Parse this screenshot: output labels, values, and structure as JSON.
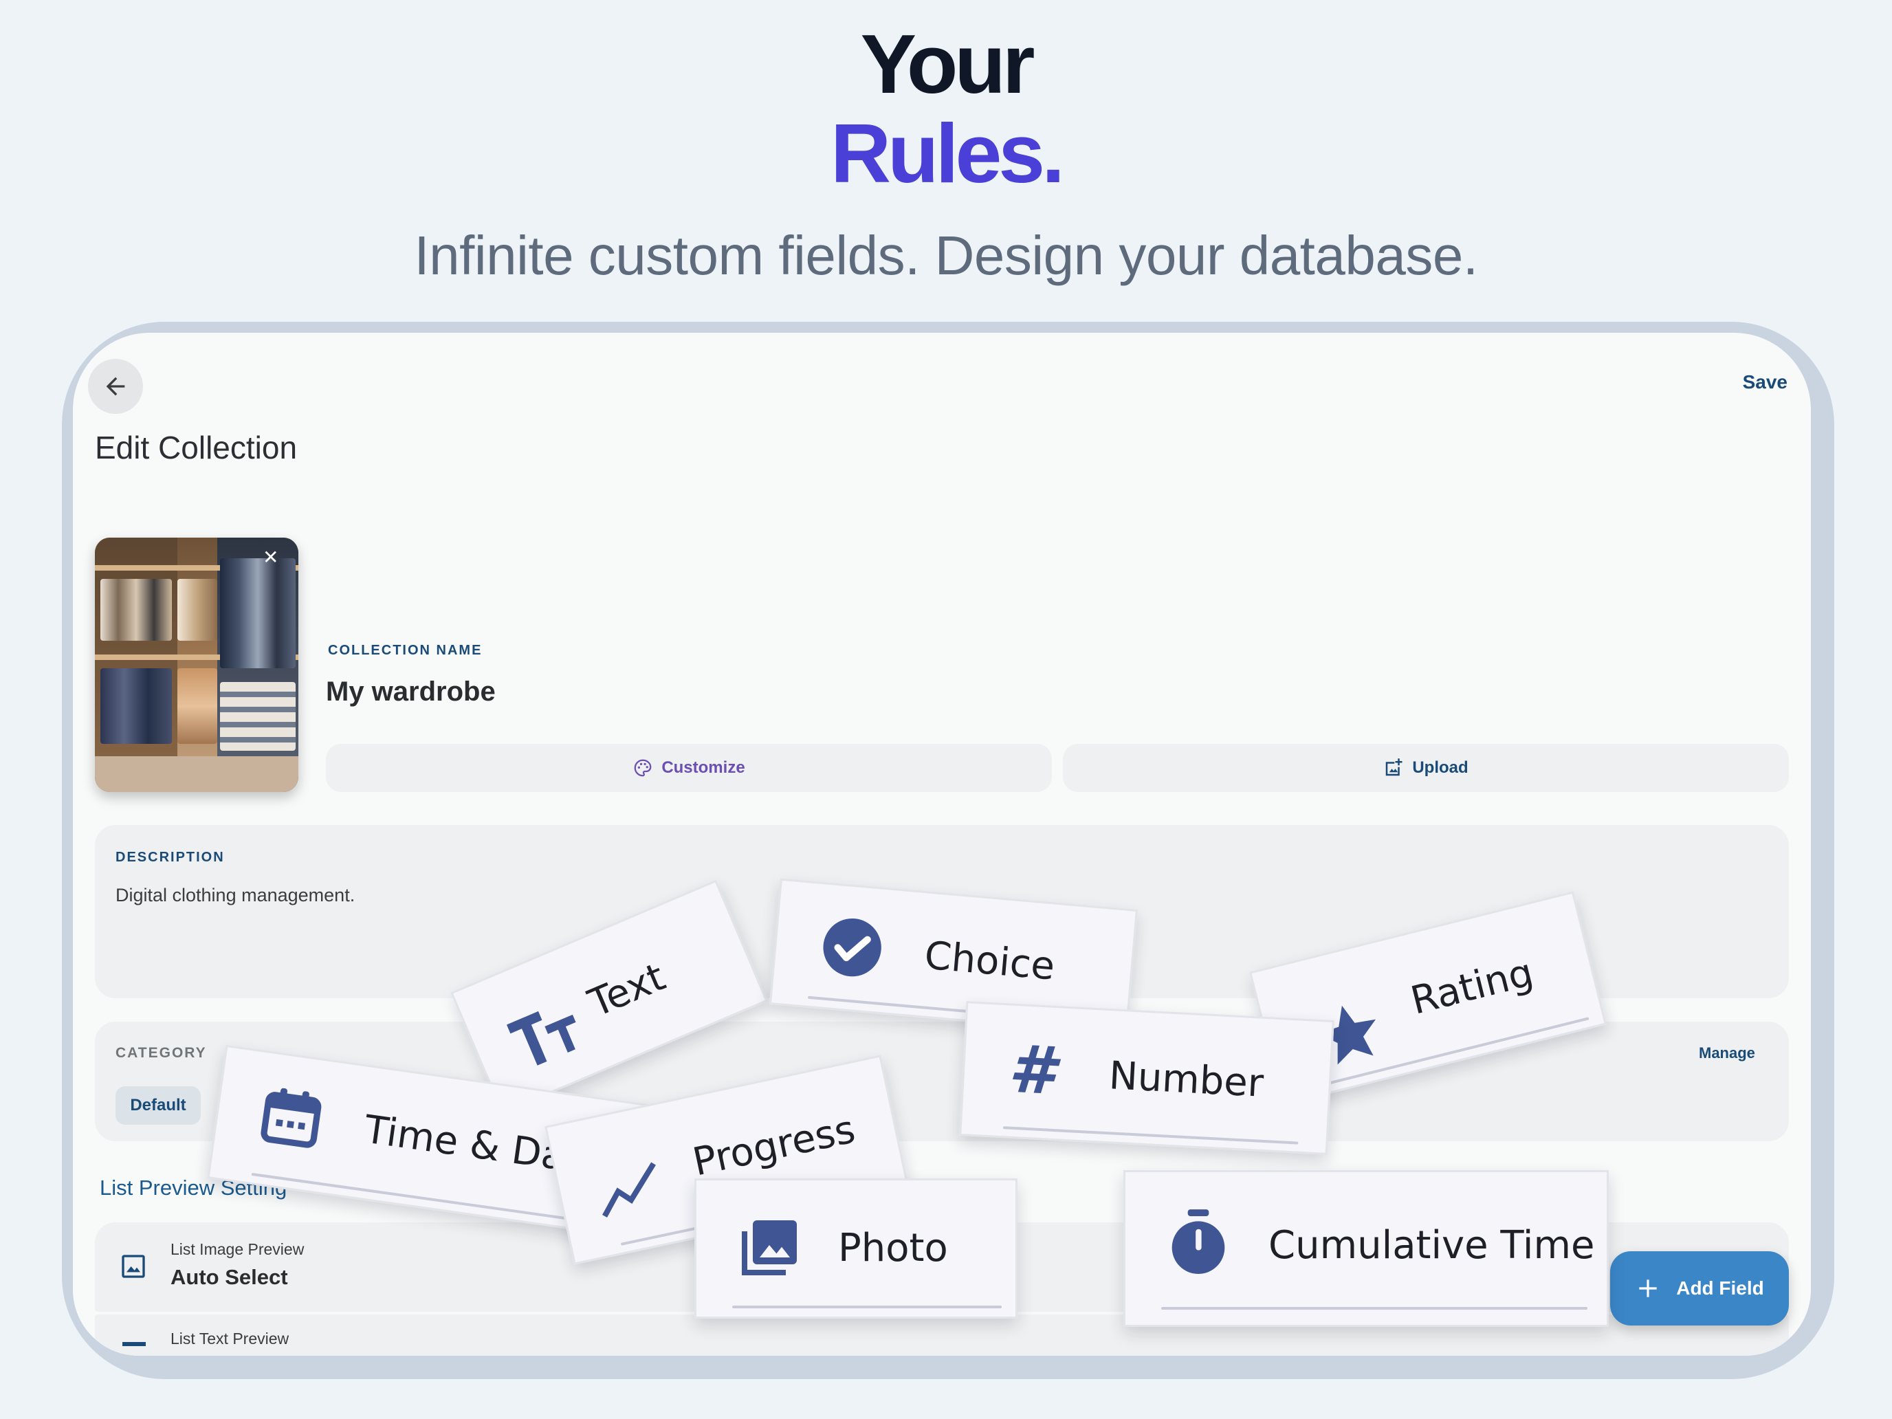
{
  "hero": {
    "line1": "Your",
    "line2": "Rules.",
    "subtitle": "Infinite custom fields. Design your database."
  },
  "app": {
    "save_label": "Save",
    "page_title": "Edit Collection",
    "collection_name_label": "COLLECTION NAME",
    "collection_name": "My wardrobe",
    "customize_label": "Customize",
    "upload_label": "Upload",
    "description_label": "DESCRIPTION",
    "description": "Digital clothing management.",
    "category_label": "CATEGORY",
    "manage_label": "Manage",
    "category_chip": "Default",
    "list_preview_title": "List Preview Setting",
    "image_preview_label": "List Image Preview",
    "image_preview_value": "Auto Select",
    "text_preview_label": "List Text Preview",
    "add_field_label": "Add Field"
  },
  "field_types": {
    "text": "Text",
    "choice": "Choice",
    "rating": "Rating",
    "number": "Number",
    "time_date": "Time & Date",
    "progress": "Progress",
    "photo": "Photo",
    "cumulative_time": "Cumulative Time"
  },
  "colors": {
    "accent": "#4a3fd6",
    "primary": "#1a4b78",
    "fab": "#3b86c7",
    "icon": "#3f5594"
  }
}
